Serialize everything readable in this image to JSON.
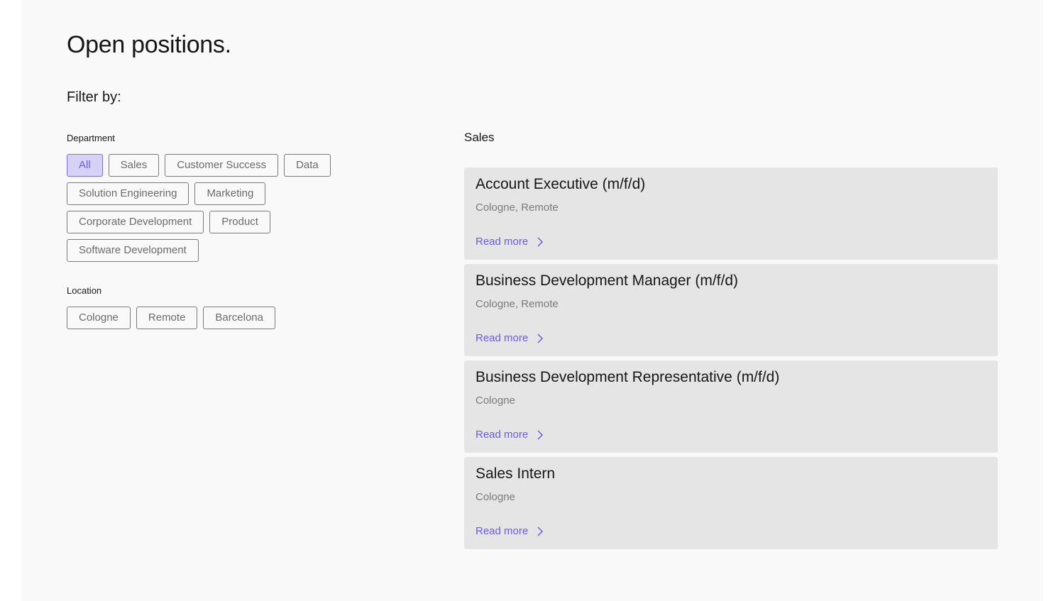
{
  "page": {
    "title": "Open positions.",
    "filter_heading": "Filter by:"
  },
  "filters": {
    "department": {
      "label": "Department",
      "options": [
        "All",
        "Sales",
        "Customer Success",
        "Data",
        "Solution Engineering",
        "Marketing",
        "Corporate Development",
        "Product",
        "Software Development"
      ],
      "selected": "All"
    },
    "location": {
      "label": "Location",
      "options": [
        "Cologne",
        "Remote",
        "Barcelona"
      ],
      "selected": ""
    }
  },
  "results": {
    "section_title": "Sales",
    "read_more_label": "Read more",
    "jobs": [
      {
        "title": "Account Executive (m/f/d)",
        "location": "Cologne, Remote"
      },
      {
        "title": "Business Development Manager (m/f/d)",
        "location": "Cologne, Remote"
      },
      {
        "title": "Business Development Representative (m/f/d)",
        "location": "Cologne"
      },
      {
        "title": "Sales Intern",
        "location": "Cologne"
      }
    ]
  },
  "colors": {
    "accent": "#6a5be0",
    "chip_active_bg": "#d6d2f6",
    "card_bg": "#e5e5e5",
    "page_bg": "#f9f9f9"
  },
  "icons": {
    "read_more": "chevron-right-icon"
  }
}
